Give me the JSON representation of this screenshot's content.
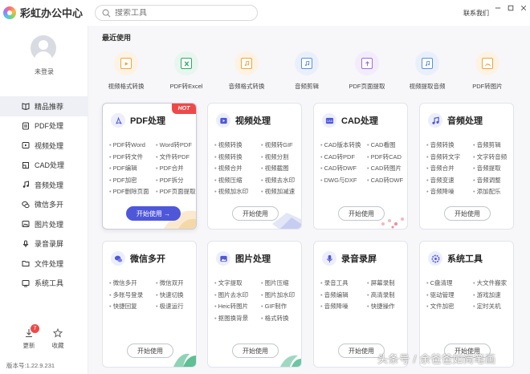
{
  "app": {
    "name": "彩虹办公中心",
    "contact": "联系我们"
  },
  "search": {
    "placeholder": "搜索工具"
  },
  "sidebar": {
    "login": "未登录",
    "items": [
      {
        "label": "精品推荐",
        "icon": "book-icon"
      },
      {
        "label": "PDF处理",
        "icon": "pdf-icon"
      },
      {
        "label": "视频处理",
        "icon": "video-icon"
      },
      {
        "label": "CAD处理",
        "icon": "cad-icon"
      },
      {
        "label": "音频处理",
        "icon": "music-icon"
      },
      {
        "label": "微信多开",
        "icon": "wechat-icon"
      },
      {
        "label": "图片处理",
        "icon": "image-icon"
      },
      {
        "label": "录音录屏",
        "icon": "record-icon"
      },
      {
        "label": "文件处理",
        "icon": "folder-icon"
      },
      {
        "label": "系统工具",
        "icon": "tools-icon"
      }
    ],
    "update_label": "更新",
    "update_badge": "7",
    "favorite_label": "收藏",
    "version": "版本号:1.22.9.231"
  },
  "recent": {
    "title": "最近使用",
    "items": [
      {
        "label": "视频格式转换",
        "color": "#f2a33a"
      },
      {
        "label": "PDF转Excel",
        "color": "#2fa86a"
      },
      {
        "label": "音频格式转换",
        "color": "#f2a33a"
      },
      {
        "label": "音频剪辑",
        "color": "#5b8fe6"
      },
      {
        "label": "PDF页面提取",
        "color": "#9b6fe0"
      },
      {
        "label": "视频提取音频",
        "color": "#5b8fe6"
      },
      {
        "label": "PDF转图片",
        "color": "#f2a33a"
      }
    ]
  },
  "cards": [
    {
      "title": "PDF处理",
      "icon": "pdf-icon",
      "hot": "HOT",
      "button": "开始使用 →",
      "features": [
        "PDF转Word",
        "Word转PDF",
        "PDF转文件",
        "文件转PDF",
        "PDF编辑",
        "PDF合并",
        "PDF加密",
        "PDF拆分",
        "PDF删除页面",
        "PDF页面提取"
      ]
    },
    {
      "title": "视频处理",
      "icon": "video-icon",
      "button": "开始使用",
      "features": [
        "视频转换",
        "视频转GIF",
        "视频转换",
        "视频分割",
        "视频合并",
        "视频截图",
        "视频压缩",
        "视频去水印",
        "视频加水印",
        "视频加减速"
      ]
    },
    {
      "title": "CAD处理",
      "icon": "cad-icon",
      "button": "开始使用",
      "features": [
        "CAD版本转换",
        "CAD看图",
        "CAD转PDF",
        "PDF转CAD",
        "CAD转DWF",
        "CAD转图片",
        "DWG与DXF",
        "CAD转DWF"
      ]
    },
    {
      "title": "音频处理",
      "icon": "music-icon",
      "button": "开始使用",
      "features": [
        "音频转换",
        "音频剪辑",
        "音频转文字",
        "文字转音频",
        "音频合并",
        "音频提取",
        "音频变速",
        "音频调整",
        "音频降噪",
        "添加配乐"
      ]
    },
    {
      "title": "微信多开",
      "icon": "wechat-icon",
      "button": "开始使用",
      "features": [
        "微信多开",
        "微信双开",
        "多账号登录",
        "快速切换",
        "快捷回复",
        "极速运行"
      ]
    },
    {
      "title": "图片处理",
      "icon": "image-icon",
      "button": "开始使用",
      "features": [
        "文字提取",
        "图片压缩",
        "图片去水印",
        "图片加水印",
        "Heic转图片",
        "GIF制作",
        "抠图换背景",
        "格式转换"
      ]
    },
    {
      "title": "录音录屏",
      "icon": "mic-icon",
      "button": "开始使用",
      "features": [
        "录音工具",
        "屏幕录制",
        "音频编辑",
        "高清录制",
        "音频降噪",
        "快捷操作"
      ]
    },
    {
      "title": "系统工具",
      "icon": "gear-icon",
      "button": "开始使用",
      "features": [
        "C盘清理",
        "大文件搬家",
        "驱动管理",
        "游戏加速",
        "文件加密",
        "定时关机"
      ]
    }
  ],
  "watermark": "头条号 / 余爸爸如简笔画",
  "colors": {
    "accent": "#4f57d9",
    "hot": "#f04848"
  }
}
